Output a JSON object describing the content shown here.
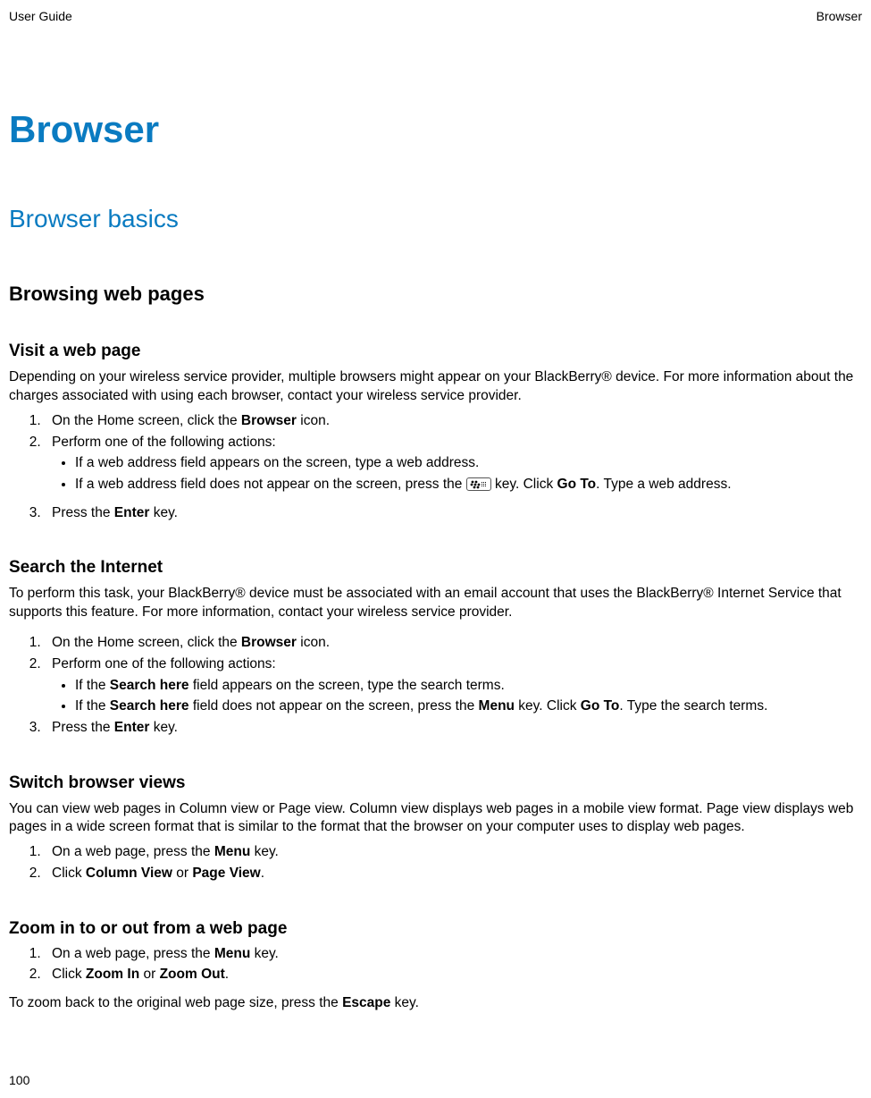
{
  "header": {
    "left": "User Guide",
    "right": "Browser"
  },
  "chapter": "Browser",
  "section": "Browser basics",
  "subsection": "Browsing web pages",
  "topics": {
    "visit": {
      "title": "Visit a web page",
      "intro": "Depending on your wireless service provider, multiple browsers might appear on your BlackBerry® device. For more information about the charges associated with using each browser, contact your wireless service provider.",
      "step1_a": "On the Home screen, click the ",
      "step1_b": "Browser",
      "step1_c": " icon.",
      "step2": "Perform one of the following actions:",
      "bullet1": "If a web address field appears on the screen, type a web address.",
      "bullet2_a": "If a web address field does not appear on the screen, press the ",
      "bullet2_b": " key. Click ",
      "bullet2_c": "Go To",
      "bullet2_d": ". Type a web address.",
      "step3_a": "Press the ",
      "step3_b": "Enter",
      "step3_c": " key."
    },
    "search": {
      "title": "Search the Internet",
      "intro": "To perform this task, your BlackBerry® device must be associated with an email account that uses the BlackBerry® Internet Service that supports this feature. For more information, contact your wireless service provider.",
      "step1_a": "On the Home screen, click the ",
      "step1_b": "Browser",
      "step1_c": " icon.",
      "step2": "Perform one of the following actions:",
      "bullet1_a": "If the ",
      "bullet1_b": "Search here",
      "bullet1_c": " field appears on the screen, type the search terms.",
      "bullet2_a": "If the ",
      "bullet2_b": "Search here",
      "bullet2_c": " field does not appear on the screen, press the ",
      "bullet2_d": "Menu",
      "bullet2_e": " key. Click ",
      "bullet2_f": "Go To",
      "bullet2_g": ". Type the search terms.",
      "step3_a": "Press the ",
      "step3_b": "Enter",
      "step3_c": " key."
    },
    "switch": {
      "title": "Switch browser views",
      "intro": "You can view web pages in Column view or Page view. Column view displays web pages in a mobile view format. Page view displays web pages in a wide screen format that is similar to the format that the browser on your computer uses to display web pages.",
      "step1_a": "On a web page, press the ",
      "step1_b": "Menu",
      "step1_c": " key.",
      "step2_a": "Click ",
      "step2_b": "Column View",
      "step2_c": " or ",
      "step2_d": "Page View",
      "step2_e": "."
    },
    "zoom": {
      "title": "Zoom in to or out from a web page",
      "step1_a": "On a web page, press the ",
      "step1_b": "Menu",
      "step1_c": " key.",
      "step2_a": "Click ",
      "step2_b": "Zoom In",
      "step2_c": " or ",
      "step2_d": "Zoom Out",
      "step2_e": ".",
      "post_a": "To zoom back to the original web page size, press the ",
      "post_b": "Escape",
      "post_c": " key."
    }
  },
  "pageNumber": "100"
}
